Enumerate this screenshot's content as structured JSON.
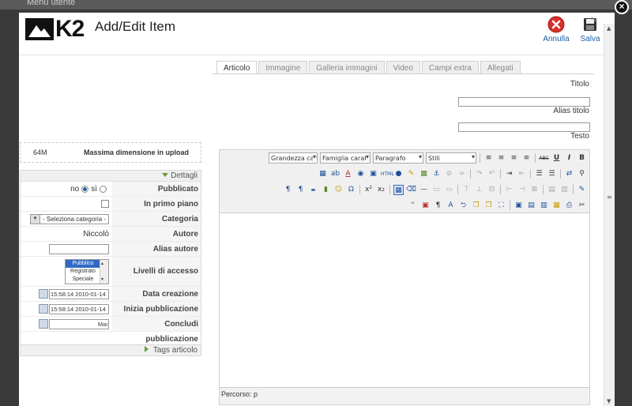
{
  "background": {
    "menu_label": "Menu utente"
  },
  "header": {
    "logo_text": "K2",
    "title": "Add/Edit Item",
    "cancel_label": "Annulla",
    "save_label": "Salva",
    "cancel_icon": "cancel-icon",
    "save_icon": "floppy-disk-icon"
  },
  "upload": {
    "value": "64M",
    "label": "Massima dimensione in upload"
  },
  "details": {
    "header": "Dettagli",
    "published": {
      "label": "Pubblicato",
      "no": "no",
      "yes": "sì",
      "selected": "no"
    },
    "featured": {
      "label": "In primo piano",
      "checked": false
    },
    "category": {
      "label": "Categoria",
      "value": "- Seleziona categoria -"
    },
    "author": {
      "label": "Autore",
      "value": "Niccolò"
    },
    "author_alias": {
      "label": "Alias autore",
      "value": ""
    },
    "access": {
      "label": "Livelli di accesso",
      "options": [
        "Pubblico",
        "Registrato",
        "Speciale"
      ],
      "selected": "Pubblico"
    },
    "created": {
      "label": "Data creazione",
      "value": "15:58:14 2010-01-14"
    },
    "publish_up": {
      "label": "Inizia pubblicazione",
      "value": "15:58:14 2010-01-14"
    },
    "publish_down": {
      "label": "Concludi pubblicazione",
      "value": "Mai"
    }
  },
  "tags": {
    "header": "Tags articolo"
  },
  "tabs": [
    "Articolo",
    "Immagine",
    "Galleria immagini",
    "Video",
    "Campi extra",
    "Allegati"
  ],
  "active_tab": "Articolo",
  "form": {
    "title_label": "Titolo",
    "alias_label": "Alias titolo",
    "text_label": "Testo"
  },
  "editor": {
    "font_size": "Grandezza car.",
    "font_family": "Famiglia caratt.",
    "format": "Paragrafo",
    "styles": "Stili",
    "path": "Percorso: p"
  },
  "colors": {
    "link": "#1b5fa8",
    "cancel_red": "#d9302b",
    "tag_arrow": "#5fa23a"
  }
}
